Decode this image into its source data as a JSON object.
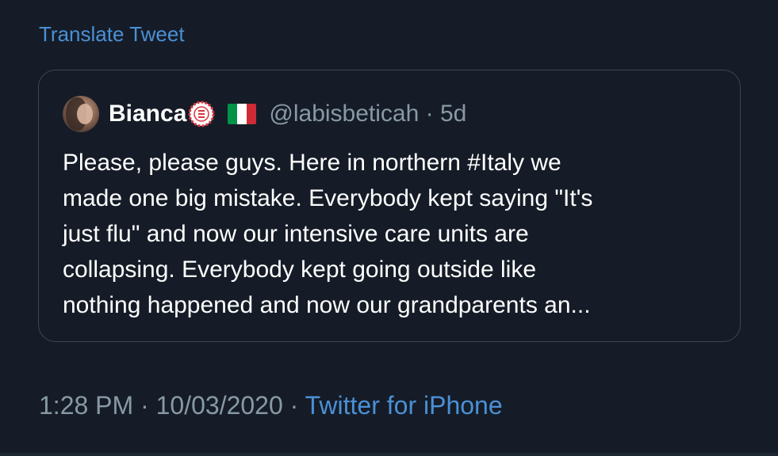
{
  "translate": {
    "label": "Translate Tweet"
  },
  "quoted_tweet": {
    "display_name": "Bianca",
    "badge_icon": "ribbon-badge-icon",
    "flag_icon": "italy-flag-icon",
    "flag_colors": [
      "#009246",
      "#ffffff",
      "#ce2b37"
    ],
    "handle": "@labisbeticah",
    "separator": "·",
    "age": "5d",
    "lines": [
      "Please, please guys. Here in northern #Italy we",
      "made one big mistake. Everybody kept saying \"It's",
      "just flu\" and now our intensive care units are",
      "collapsing. Everybody kept going outside like",
      "nothing happened and now our grandparents an..."
    ]
  },
  "meta": {
    "time": "1:28 PM",
    "separator": "·",
    "date": "10/03/2020",
    "source": "Twitter for iPhone"
  },
  "colors": {
    "background": "#151c27",
    "link": "#4a90d6",
    "secondary_text": "#8899a6",
    "border": "#3b4654"
  }
}
